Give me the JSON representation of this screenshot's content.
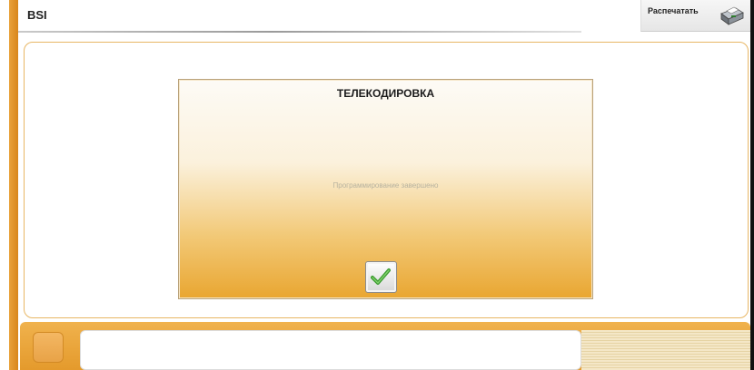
{
  "app": {
    "title": "BSI"
  },
  "toolbar": {
    "print_label": "Распечатать"
  },
  "dialog": {
    "title": "ТЕЛЕКОДИРОВКА",
    "message": "Программирование завершено"
  },
  "colors": {
    "accent_orange": "#e9a13a",
    "dialog_gradient_top": "#fdfbf6",
    "dialog_gradient_bottom": "#e9a631",
    "check_green": "#3a9a2f"
  },
  "icons": {
    "print": "printer-icon",
    "ok": "checkmark-icon"
  }
}
